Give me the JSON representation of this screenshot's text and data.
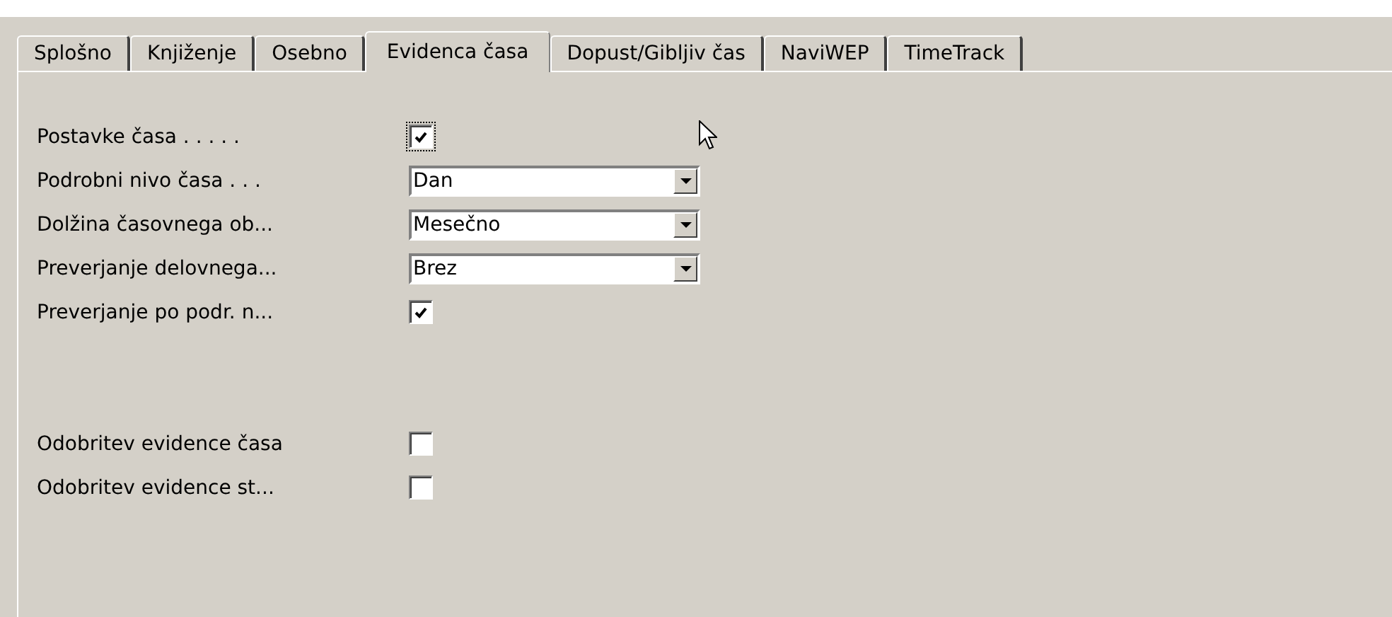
{
  "tabs": [
    {
      "label": "Splošno",
      "selected": false
    },
    {
      "label": "Knjiženje",
      "selected": false
    },
    {
      "label": "Osebno",
      "selected": false
    },
    {
      "label": "Evidenca časa",
      "selected": true
    },
    {
      "label": "Dopust/Gibljiv čas",
      "selected": false
    },
    {
      "label": "NaviWEP",
      "selected": false
    },
    {
      "label": "TimeTrack",
      "selected": false
    }
  ],
  "fields": [
    {
      "kind": "checkbox",
      "label": "Postavke časa . . . . .",
      "checked": true,
      "focused": true
    },
    {
      "kind": "combo",
      "label": "Podrobni nivo časa . . .",
      "value": "Dan"
    },
    {
      "kind": "combo",
      "label": "Dolžina časovnega ob...",
      "value": "Mesečno"
    },
    {
      "kind": "combo",
      "label": "Preverjanje delovnega...",
      "value": "Brez"
    },
    {
      "kind": "checkbox",
      "label": "Preverjanje po podr. n...",
      "checked": true,
      "focused": false
    },
    {
      "kind": "spacer"
    },
    {
      "kind": "checkbox",
      "label": "Odobritev evidence časa",
      "checked": false,
      "focused": false
    },
    {
      "kind": "checkbox",
      "label": "Odobritev evidence st...",
      "checked": false,
      "focused": false
    }
  ]
}
